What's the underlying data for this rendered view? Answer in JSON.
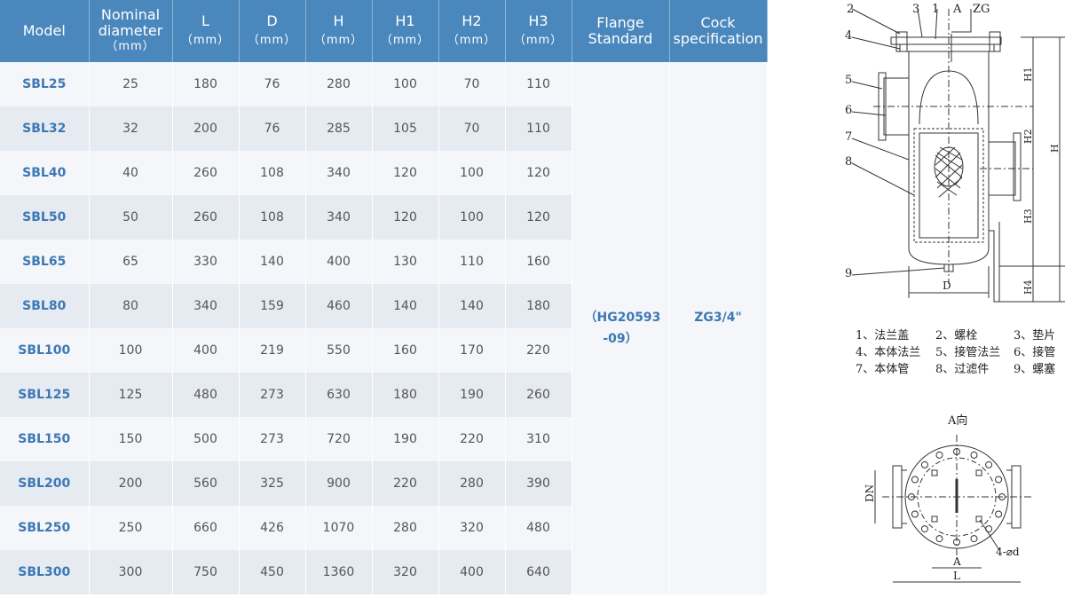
{
  "table": {
    "headers": [
      {
        "label": "Model",
        "unit": ""
      },
      {
        "label": "Nominal diameter",
        "unit": "（mm）"
      },
      {
        "label": "L",
        "unit": "（mm）"
      },
      {
        "label": "D",
        "unit": "（mm）"
      },
      {
        "label": "H",
        "unit": "（mm）"
      },
      {
        "label": "H1",
        "unit": "（mm）"
      },
      {
        "label": "H2",
        "unit": "（mm）"
      },
      {
        "label": "H3",
        "unit": "（mm）"
      },
      {
        "label": "Flange Standard",
        "unit": ""
      },
      {
        "label": "Cock specification",
        "unit": ""
      }
    ],
    "rows": [
      [
        "SBL25",
        "25",
        "180",
        "76",
        "280",
        "100",
        "70",
        "110"
      ],
      [
        "SBL32",
        "32",
        "200",
        "76",
        "285",
        "105",
        "70",
        "110"
      ],
      [
        "SBL40",
        "40",
        "260",
        "108",
        "340",
        "120",
        "100",
        "120"
      ],
      [
        "SBL50",
        "50",
        "260",
        "108",
        "340",
        "120",
        "100",
        "120"
      ],
      [
        "SBL65",
        "65",
        "330",
        "140",
        "400",
        "130",
        "110",
        "160"
      ],
      [
        "SBL80",
        "80",
        "340",
        "159",
        "460",
        "140",
        "140",
        "180"
      ],
      [
        "SBL100",
        "100",
        "400",
        "219",
        "550",
        "160",
        "170",
        "220"
      ],
      [
        "SBL125",
        "125",
        "480",
        "273",
        "630",
        "180",
        "190",
        "260"
      ],
      [
        "SBL150",
        "150",
        "500",
        "273",
        "720",
        "190",
        "220",
        "310"
      ],
      [
        "SBL200",
        "200",
        "560",
        "325",
        "900",
        "220",
        "280",
        "390"
      ],
      [
        "SBL250",
        "250",
        "660",
        "426",
        "1070",
        "280",
        "320",
        "480"
      ],
      [
        "SBL300",
        "300",
        "750",
        "450",
        "1360",
        "320",
        "400",
        "640"
      ]
    ],
    "flange_standard": "（HG20593 -09）",
    "cock_specification": "ZG3/4\""
  },
  "drawing": {
    "part_numbers": [
      "2",
      "3",
      "1",
      "4",
      "5",
      "6",
      "7",
      "8",
      "9"
    ],
    "top_labels": {
      "a": "A",
      "zg": "ZG"
    },
    "dims": {
      "h1": "H1",
      "h2": "H2",
      "h": "H",
      "h3": "H3",
      "h4": "H4",
      "d": "D",
      "dn": "DN",
      "a": "A",
      "l": "L",
      "bolt": "4-⌀d"
    },
    "legend": [
      "1、法兰盖",
      "2、螺栓",
      "3、垫片",
      "4、本体法兰",
      "5、接管法兰",
      "6、接管",
      "7、本体管",
      "8、过滤件",
      "9、螺塞"
    ],
    "view_title": "A向"
  },
  "colors": {
    "header_bg": "#4a87bd",
    "model_text": "#3d78b4",
    "row_light": "#f4f6f9",
    "row_dark": "#e6ebf2"
  }
}
